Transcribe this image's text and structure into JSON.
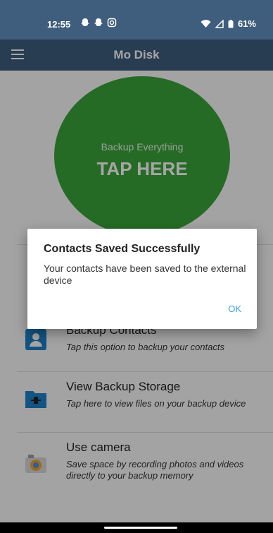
{
  "status_bar": {
    "time": "12:55",
    "battery": "61%",
    "icons": [
      "snapchat-icon",
      "snapchat-icon",
      "instagram-icon",
      "wifi-icon",
      "signal-icon",
      "battery-icon"
    ]
  },
  "app_bar": {
    "title": "Mo Disk"
  },
  "backup_button": {
    "subtitle": "Backup Everything",
    "label": "TAP HERE",
    "color": "#39a53a"
  },
  "list": [
    {
      "title": "Backup Contacts",
      "desc": "Tap this option to backup your contacts"
    },
    {
      "title": "View Backup Storage",
      "desc": "Tap here to view files on your backup device"
    },
    {
      "title": "Use camera",
      "desc": "Save space by recording photos and videos directly to your backup memory"
    }
  ],
  "dialog": {
    "title": "Contacts Saved Successfully",
    "message": "Your contacts have been saved to the external device",
    "ok_label": "OK"
  },
  "colors": {
    "primary": "#3f5e7e",
    "accent": "#3c9be8",
    "green": "#39a53a"
  }
}
